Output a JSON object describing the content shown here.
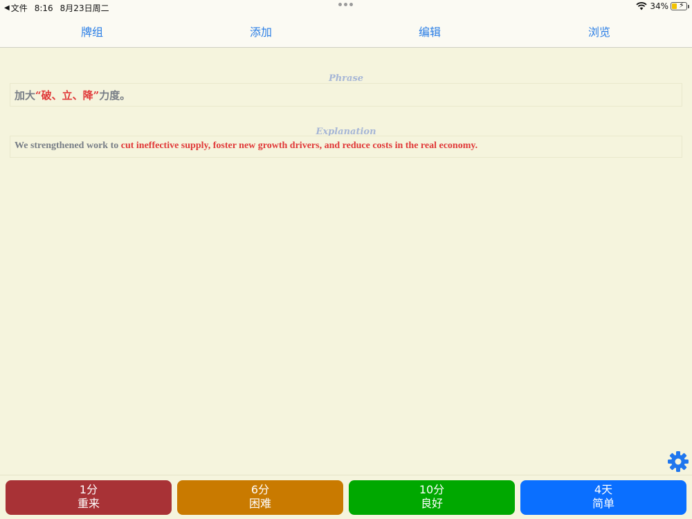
{
  "status_bar": {
    "back_arrow": "◀",
    "back_label": "文件",
    "time": "8:16",
    "date": "8月23日周二",
    "battery_pct": "34%",
    "battery_level": 0.34,
    "charging_glyph": "⚡"
  },
  "nav": {
    "deck": "牌组",
    "add": "添加",
    "edit": "编辑",
    "browse": "浏览"
  },
  "card": {
    "phrase_label": "Phrase",
    "phrase_pre": "加大",
    "phrase_hl": "“破、立、降”",
    "phrase_post": "力度。",
    "explanation_label": "Explanation",
    "expl_pre": "We strengthened work to ",
    "expl_hl": "cut ineffective supply, foster new growth drivers, and reduce costs in the real economy",
    "expl_post": "."
  },
  "answers": [
    {
      "time": "1分",
      "label": "重来",
      "color": "#a83236"
    },
    {
      "time": "6分",
      "label": "困难",
      "color": "#c97a00"
    },
    {
      "time": "10分",
      "label": "良好",
      "color": "#00a800"
    },
    {
      "time": "4天",
      "label": "简单",
      "color": "#0a6fff"
    }
  ],
  "colors": {
    "link": "#2a7ee6",
    "highlight": "#e03838",
    "gear": "#1f76ee"
  }
}
